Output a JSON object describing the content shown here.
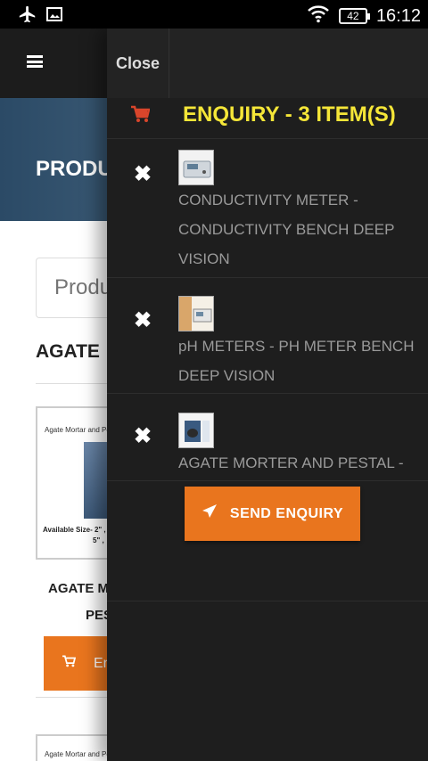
{
  "status_bar": {
    "battery": "42",
    "time": "16:12",
    "icons": [
      "airplane-icon",
      "image-icon",
      "wifi-icon",
      "battery-icon"
    ]
  },
  "page": {
    "hero_title": "PRODU",
    "search_placeholder": "Produ",
    "section_heading": "AGATE",
    "product_card": {
      "top_text": "Agate Mortar and Pest",
      "size_text": "Available Size- 2\" ,",
      "size_text2": "5\" ,"
    },
    "product_name_line1": "AGATE M",
    "product_name_line2": "PES",
    "enquire_label": "En",
    "product_card2_text": "Agate Mortar and Pe"
  },
  "drawer": {
    "close_label": "Close",
    "enquiry_title": "ENQUIRY - 3 ITEM(S)",
    "items": [
      {
        "name": "CONDUCTIVITY METER - CONDUCTIVITY BENCH DEEP VISION"
      },
      {
        "name": "pH METERS - PH METER BENCH DEEP VISION"
      },
      {
        "name": "AGATE MORTER AND PESTAL -"
      }
    ],
    "send_label": "SEND ENQUIRY"
  },
  "colors": {
    "accent_orange": "#e9751e",
    "title_yellow": "#f5e638",
    "cart_red": "#d9452b",
    "drawer_bg": "#1e1e1e"
  }
}
